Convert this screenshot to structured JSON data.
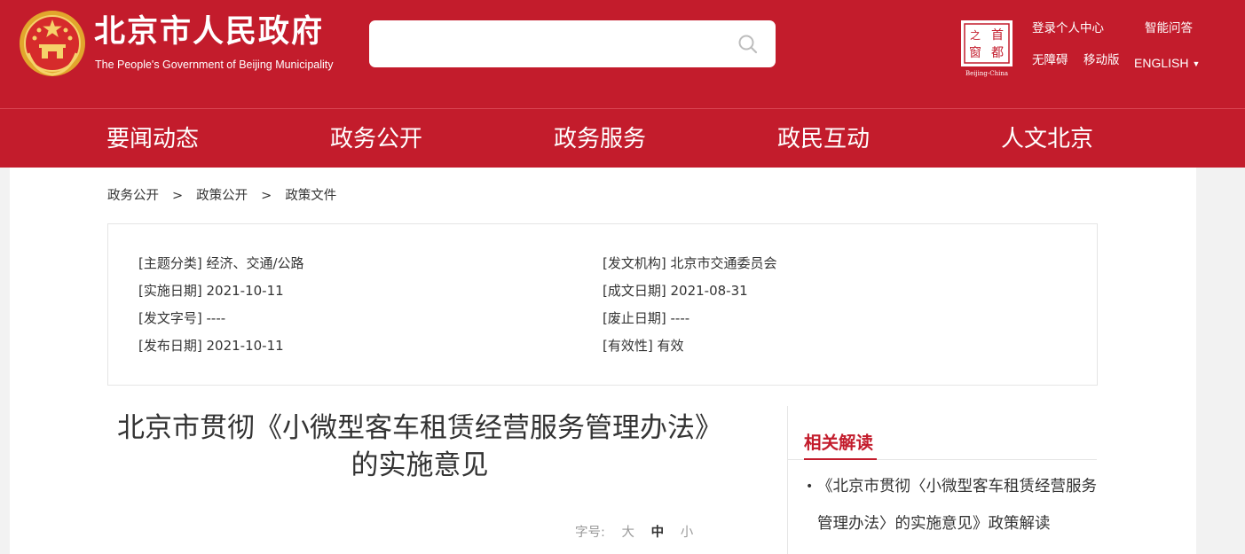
{
  "header": {
    "site_name_cn": "北京市人民政府",
    "site_name_en": "The People's Government of Beijing Municipality",
    "search": {
      "value": "",
      "placeholder": ""
    },
    "seal": {
      "chars": [
        "首",
        "都",
        "之",
        "窗"
      ],
      "caption": "Beijing-China"
    },
    "links": {
      "login": "登录个人中心",
      "qa": "智能问答",
      "accessibility": "无障碍",
      "mobile": "移动版",
      "english": "ENGLISH"
    },
    "colors": {
      "brand_red": "#c31c2c",
      "gold": "#f2c230"
    }
  },
  "nav": {
    "items": [
      "要闻动态",
      "政务公开",
      "政务服务",
      "政民互动",
      "人文北京"
    ]
  },
  "breadcrumb": {
    "items": [
      "政务公开",
      "政策公开",
      "政策文件"
    ],
    "separator": ">"
  },
  "info": {
    "left": [
      {
        "label": "[主题分类]",
        "value": "经济、交通/公路"
      },
      {
        "label": "[实施日期]",
        "value": "2021-10-11"
      },
      {
        "label": "[发文字号]",
        "value": "----"
      },
      {
        "label": "[发布日期]",
        "value": "2021-10-11"
      }
    ],
    "right": [
      {
        "label": "[发文机构]",
        "value": "北京市交通委员会"
      },
      {
        "label": "[成文日期]",
        "value": "2021-08-31"
      },
      {
        "label": "[废止日期]",
        "value": "----"
      },
      {
        "label": "[有效性]",
        "value": "有效"
      }
    ]
  },
  "article": {
    "title_line1": "北京市贯彻《小微型客车租赁经营服务管理办法》",
    "title_line2": "的实施意见"
  },
  "fontsize": {
    "label": "字号:",
    "options": [
      "大",
      "中",
      "小"
    ],
    "selected": "中"
  },
  "related": {
    "heading": "相关解读",
    "bullet": "•",
    "items": [
      "《北京市贯彻〈小微型客车租赁经营服务管理办法〉的实施意见》政策解读"
    ]
  }
}
